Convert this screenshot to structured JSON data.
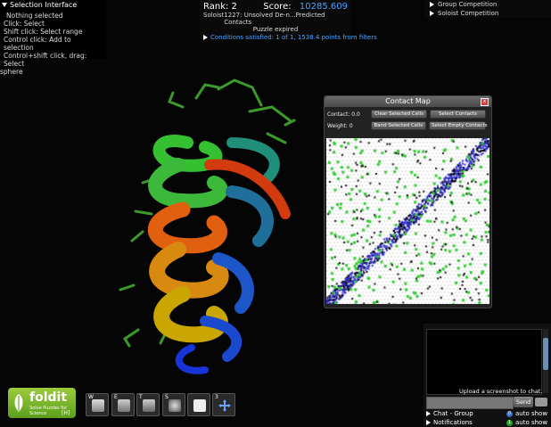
{
  "selection_panel": {
    "title": "Selection Interface",
    "lines": [
      "Nothing selected",
      "Click: Select",
      "Shift click: Select range",
      "Control click: Add to selection",
      "Control+shift click, drag: Select",
      "sphere"
    ]
  },
  "score_panel": {
    "rank_label": "Rank: 2",
    "score_label": "Score:",
    "score_value": "10285.609",
    "player": "Soloist",
    "puzzle": "1227: Unsolved De-n...Predicted Contacts",
    "status": "Puzzle expired",
    "conditions": "Conditions satisfied: 1 of 1, 1538.4 points from filters"
  },
  "competition": {
    "items": [
      "Group Competition",
      "Soloist Competition"
    ]
  },
  "contact_map": {
    "title": "Contact Map",
    "close": "x",
    "contact_label": "Contact: 0.0",
    "weight_label": "Weight: 0",
    "buttons": [
      "Clear Selected Cells",
      "Select Contacts",
      "Band Selected Cells",
      "Select Empty Contacts"
    ]
  },
  "chat": {
    "upload_text": "Upload a screenshot to chat.",
    "send_label": "Send",
    "tab_chat": "Chat - Group",
    "tab_notifications": "Notifications",
    "auto_show_1": "auto show",
    "auto_show_2": "auto show",
    "badge_1": "0",
    "badge_2": "1"
  },
  "logo": {
    "word": "foldit",
    "tagline": "Solve Puzzles for Science",
    "tag": "[H]"
  },
  "toolbar": {
    "keys": [
      "W",
      "E",
      "T",
      "S",
      "",
      "3"
    ]
  },
  "colors": {
    "accent_blue": "#4aa3ff",
    "logo_green": "#8fc03a",
    "contact_green": "#33cc33",
    "contact_blue": "#3333cc"
  }
}
